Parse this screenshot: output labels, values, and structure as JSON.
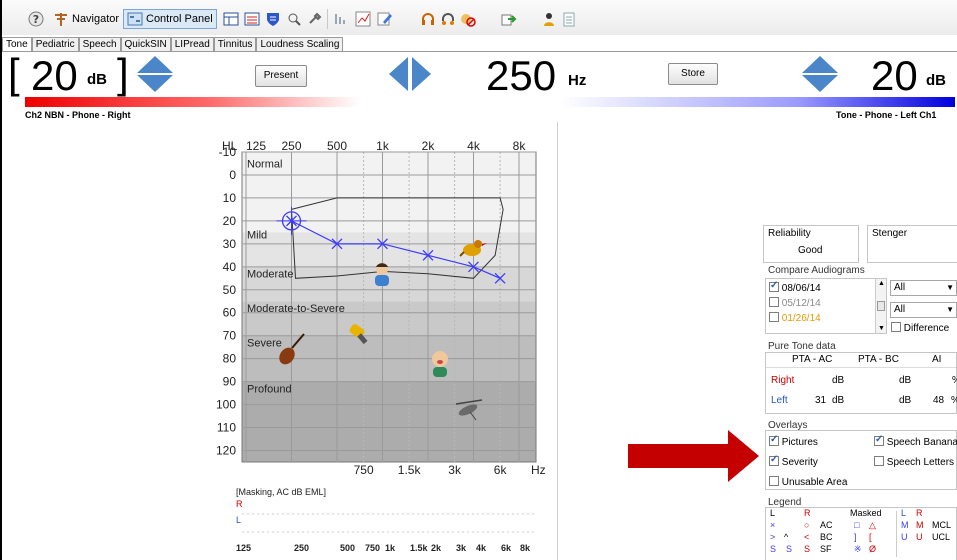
{
  "toolbar": {
    "navigator_label": "Navigator",
    "control_panel_label": "Control Panel"
  },
  "tabs": [
    "Tone",
    "Pediatric",
    "Speech",
    "QuickSIN",
    "LIPread",
    "Tinnitus",
    "Loudness Scaling"
  ],
  "controls": {
    "left_level": "20",
    "left_unit": "dB",
    "frequency": "250",
    "frequency_unit": "Hz",
    "right_level": "20",
    "right_unit": "dB",
    "present_label": "Present",
    "store_label": "Store",
    "left_channel_label": "Ch2  NBN - Phone - Right",
    "right_channel_label": "Tone - Phone - Left  Ch1",
    "left_bracket_open": "[",
    "left_bracket_close": "]"
  },
  "audiogram": {
    "y_axis_title": "HL",
    "top_freq_labels": [
      "125",
      "250",
      "500",
      "1k",
      "2k",
      "4k",
      "8k"
    ],
    "bottom_freq_labels": [
      "750",
      "1.5k",
      "3k",
      "6k"
    ],
    "bottom_axis_unit": "Hz",
    "y_ticks": [
      "-10",
      "0",
      "10",
      "20",
      "30",
      "40",
      "50",
      "60",
      "70",
      "80",
      "90",
      "100",
      "110",
      "120"
    ],
    "severity_bands": [
      {
        "label": "Normal",
        "color": "#f2f2f2"
      },
      {
        "label": "Mild",
        "color": "#e4e4e4"
      },
      {
        "label": "Moderate",
        "color": "#d7d7d7"
      },
      {
        "label": "Moderate-to-Severe",
        "color": "#c9c9c9"
      },
      {
        "label": "Severe",
        "color": "#bdbdbd"
      },
      {
        "label": "Profound",
        "color": "#acacac"
      }
    ],
    "left_series_color": "#3b3bff",
    "left_series": [
      {
        "freq": "250",
        "hl": 20,
        "marker": "cursor"
      },
      {
        "freq": "500",
        "hl": 30
      },
      {
        "freq": "1k",
        "hl": 30
      },
      {
        "freq": "2k",
        "hl": 35
      },
      {
        "freq": "4k",
        "hl": 40
      },
      {
        "freq": "6k",
        "hl": 45
      }
    ],
    "overlay_pictures": [
      "bird-icon",
      "person-icon",
      "hair-dryer-icon",
      "violin-icon",
      "baby-icon",
      "helicopter-icon"
    ]
  },
  "masking": {
    "title": "[Masking, AC dB EML]",
    "r_label": "R",
    "l_label": "L",
    "freq_labels": [
      "125",
      "250",
      "500",
      "750",
      "1k",
      "1.5k",
      "2k",
      "3k",
      "4k",
      "6k",
      "8k"
    ]
  },
  "reliability": {
    "title": "Reliability",
    "value": "Good"
  },
  "stenger": {
    "title": "Stenger"
  },
  "compare": {
    "title": "Compare Audiograms",
    "dates": [
      {
        "date": "08/06/14",
        "checked": true,
        "color": "#000000"
      },
      {
        "date": "05/12/14",
        "checked": false,
        "color": "#8a8a8a"
      },
      {
        "date": "01/26/14",
        "checked": false,
        "color": "#e39a00"
      }
    ],
    "filter1": "All",
    "filter2": "All",
    "difference_label": "Difference"
  },
  "pure_tone": {
    "title": "Pure Tone data",
    "headers": [
      "PTA - AC",
      "PTA - BC",
      "AI"
    ],
    "rows": [
      {
        "ear": "Right",
        "pta_ac": "",
        "pta_ac_unit": "dB",
        "pta_bc": "",
        "pta_bc_unit": "dB",
        "ai": "",
        "ai_unit": "%",
        "color": "#cc0000"
      },
      {
        "ear": "Left",
        "pta_ac": "31",
        "pta_ac_unit": "dB",
        "pta_bc": "",
        "pta_bc_unit": "dB",
        "ai": "48",
        "ai_unit": "%",
        "color": "#2255cc"
      }
    ]
  },
  "overlays": {
    "title": "Overlays",
    "items": [
      {
        "label": "Pictures",
        "checked": true
      },
      {
        "label": "Speech Banana",
        "checked": true
      },
      {
        "label": "Severity",
        "checked": true
      },
      {
        "label": "Speech Letters",
        "checked": false
      },
      {
        "label": "Unusable Area",
        "checked": false
      }
    ]
  },
  "legend": {
    "title": "Legend",
    "col_l": "L",
    "col_r": "R",
    "col_masked": "Masked",
    "col_l2": "L",
    "col_r2": "R",
    "rows": [
      {
        "l": "×",
        "r": "○",
        "name": "AC",
        "ml": "□",
        "mr": "△",
        "l2": "M",
        "r2": "M",
        "name2": "MCL"
      },
      {
        "l": ">",
        "r": "<",
        "name": "BC",
        "ml": "]",
        "mr": "[",
        "l2": "U",
        "r2": "U",
        "name2": "UCL"
      },
      {
        "l": "S",
        "r": "S",
        "name": "SF",
        "ml": "※",
        "mr": "Ø",
        "l2": "",
        "r2": "",
        "name2": ""
      }
    ]
  }
}
